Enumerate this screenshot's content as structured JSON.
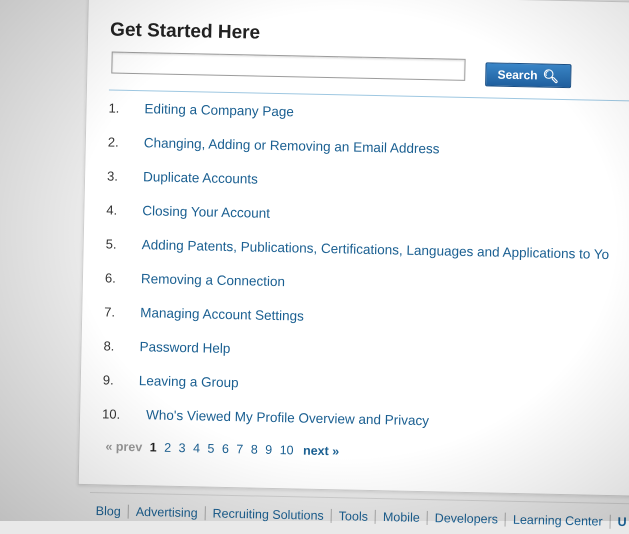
{
  "title": "Get Started Here",
  "search": {
    "placeholder": "",
    "button_label": "Search",
    "icon": "search-icon"
  },
  "items": [
    {
      "number": "1.",
      "label": "Editing a Company Page"
    },
    {
      "number": "2.",
      "label": "Changing, Adding or Removing an Email Address"
    },
    {
      "number": "3.",
      "label": "Duplicate Accounts"
    },
    {
      "number": "4.",
      "label": "Closing Your Account"
    },
    {
      "number": "5.",
      "label": "Adding Patents, Publications, Certifications, Languages and Applications to Yo"
    },
    {
      "number": "6.",
      "label": "Removing a Connection"
    },
    {
      "number": "7.",
      "label": "Managing Account Settings"
    },
    {
      "number": "8.",
      "label": "Password Help"
    },
    {
      "number": "9.",
      "label": "Leaving a Group"
    },
    {
      "number": "10.",
      "label": "Who's Viewed My Profile Overview and Privacy"
    }
  ],
  "pagination": {
    "prev": "« prev",
    "current": "1",
    "pages": [
      "2",
      "3",
      "4",
      "5",
      "6",
      "7",
      "8",
      "9",
      "10"
    ],
    "next": "next »"
  },
  "footer": {
    "links": [
      "Blog",
      "Advertising",
      "Recruiting Solutions",
      "Tools",
      "Mobile",
      "Developers",
      "Learning Center"
    ],
    "last": "U"
  }
}
